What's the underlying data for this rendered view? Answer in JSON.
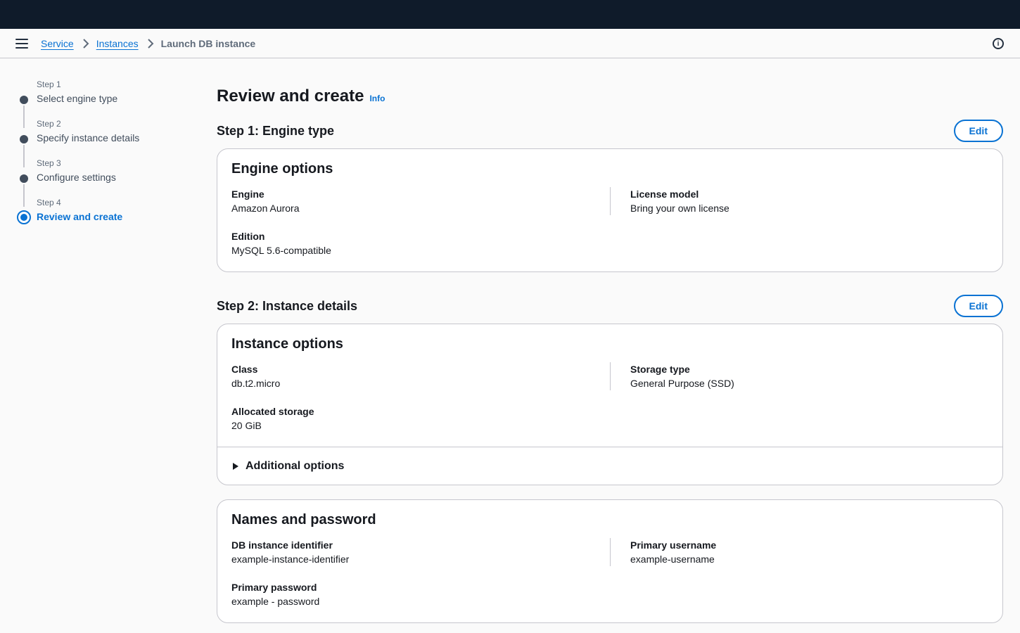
{
  "breadcrumb": {
    "items": [
      "Service",
      "Instances"
    ],
    "current": "Launch DB instance"
  },
  "icons": {
    "menu": "hamburger-menu-icon",
    "separator": "chevron-right-icon",
    "help": "info-circle-icon"
  },
  "wizard": {
    "steps": [
      {
        "label": "Step 1",
        "title": "Select engine type"
      },
      {
        "label": "Step 2",
        "title": "Specify instance details"
      },
      {
        "label": "Step 3",
        "title": "Configure settings"
      },
      {
        "label": "Step 4",
        "title": "Review and create"
      }
    ],
    "active_index": 3
  },
  "main": {
    "title": "Review and create",
    "info_label": "Info",
    "step1": {
      "heading": "Step 1: Engine type",
      "edit_label": "Edit",
      "card_title": "Engine options",
      "engine_key": "Engine",
      "engine_val": "Amazon Aurora",
      "edition_key": "Edition",
      "edition_val": "MySQL 5.6-compatible",
      "license_key": "License model",
      "license_val": "Bring your own license"
    },
    "step2": {
      "heading": "Step 2: Instance details",
      "edit_label": "Edit",
      "instance_card": {
        "title": "Instance options",
        "class_key": "Class",
        "class_val": "db.t2.micro",
        "storage_key": "Allocated storage",
        "storage_val": "20 GiB",
        "storage_type_key": "Storage type",
        "storage_type_val": "General Purpose (SSD)",
        "additional_label": "Additional options"
      },
      "names_card": {
        "title": "Names and password",
        "identifier_key": "DB instance identifier",
        "identifier_val": "example-instance-identifier",
        "password_key": "Primary password",
        "password_val": "example - password",
        "username_key": "Primary username",
        "username_val": "example-username"
      }
    }
  }
}
